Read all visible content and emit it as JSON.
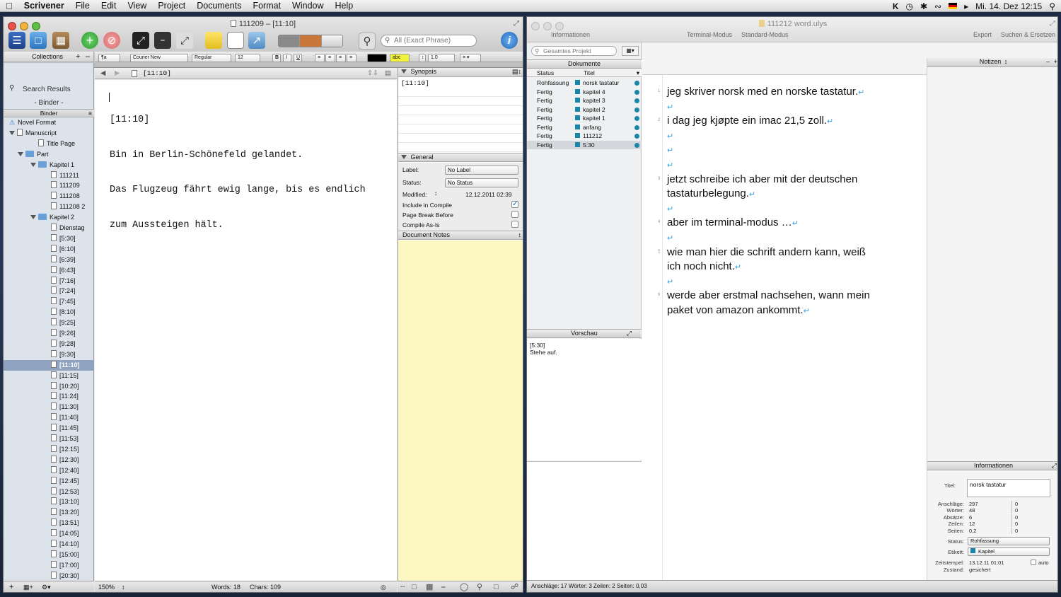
{
  "menubar": {
    "app_name": "Scrivener",
    "items": [
      "File",
      "Edit",
      "View",
      "Project",
      "Documents",
      "Format",
      "Window",
      "Help"
    ],
    "clock": "Mi. 14. Dez  12:15"
  },
  "scrivener": {
    "title": "111209 – [11:10]",
    "search_placeholder": "All (Exact Phrase)",
    "format": {
      "style": "¶a",
      "font": "Courier New",
      "weight": "Regular",
      "size": "12",
      "spacing": "1.0",
      "bold": "B",
      "italic": "I",
      "underline": "U",
      "highlight": "abc"
    },
    "collections_label": "Collections",
    "search_results_label": "Search Results",
    "binder_sep": "- Binder -",
    "binder_header": "Binder",
    "binder": [
      {
        "label": "Novel Format",
        "indent": 0,
        "icon": "warn",
        "tri": false
      },
      {
        "label": "Manuscript",
        "indent": 0,
        "icon": "doc",
        "tri": true
      },
      {
        "label": "Title Page",
        "indent": 2,
        "icon": "doc",
        "tri": false
      },
      {
        "label": "Part",
        "indent": 1,
        "icon": "folder",
        "tri": true
      },
      {
        "label": "Kapitel 1",
        "indent": 2,
        "icon": "folder",
        "tri": true
      },
      {
        "label": "111211",
        "indent": 3,
        "icon": "doc",
        "tri": false
      },
      {
        "label": "111209",
        "indent": 3,
        "icon": "doc",
        "tri": false
      },
      {
        "label": "111208",
        "indent": 3,
        "icon": "doc",
        "tri": false
      },
      {
        "label": "111208 2",
        "indent": 3,
        "icon": "doc",
        "tri": false
      },
      {
        "label": "Kapitel 2",
        "indent": 2,
        "icon": "folder",
        "tri": true
      },
      {
        "label": "Dienstag",
        "indent": 3,
        "icon": "doc",
        "tri": false
      },
      {
        "label": "[5:30]",
        "indent": 3,
        "icon": "doc",
        "tri": false
      },
      {
        "label": "[6:10]",
        "indent": 3,
        "icon": "doc",
        "tri": false
      },
      {
        "label": "[6:39]",
        "indent": 3,
        "icon": "doc",
        "tri": false
      },
      {
        "label": "[6:43]",
        "indent": 3,
        "icon": "doc",
        "tri": false
      },
      {
        "label": "[7:16]",
        "indent": 3,
        "icon": "doc",
        "tri": false
      },
      {
        "label": "[7:24]",
        "indent": 3,
        "icon": "doc",
        "tri": false
      },
      {
        "label": "[7:45]",
        "indent": 3,
        "icon": "doc",
        "tri": false
      },
      {
        "label": "[8:10]",
        "indent": 3,
        "icon": "doc",
        "tri": false
      },
      {
        "label": "[9:25]",
        "indent": 3,
        "icon": "doc",
        "tri": false
      },
      {
        "label": "[9:26]",
        "indent": 3,
        "icon": "doc",
        "tri": false
      },
      {
        "label": "[9:28]",
        "indent": 3,
        "icon": "doc",
        "tri": false
      },
      {
        "label": "[9:30]",
        "indent": 3,
        "icon": "doc",
        "tri": false
      },
      {
        "label": "[11:10]",
        "indent": 3,
        "icon": "doc",
        "tri": false,
        "selected": true
      },
      {
        "label": "[11:15]",
        "indent": 3,
        "icon": "doc",
        "tri": false
      },
      {
        "label": "[10:20]",
        "indent": 3,
        "icon": "doc",
        "tri": false
      },
      {
        "label": "[11:24]",
        "indent": 3,
        "icon": "doc",
        "tri": false
      },
      {
        "label": "[11:30]",
        "indent": 3,
        "icon": "doc",
        "tri": false
      },
      {
        "label": "[11:40]",
        "indent": 3,
        "icon": "doc",
        "tri": false
      },
      {
        "label": "[11:45]",
        "indent": 3,
        "icon": "doc",
        "tri": false
      },
      {
        "label": "[11:53]",
        "indent": 3,
        "icon": "doc",
        "tri": false
      },
      {
        "label": "[12:15]",
        "indent": 3,
        "icon": "doc",
        "tri": false
      },
      {
        "label": "[12:30]",
        "indent": 3,
        "icon": "doc",
        "tri": false
      },
      {
        "label": "[12:40]",
        "indent": 3,
        "icon": "doc",
        "tri": false
      },
      {
        "label": "[12:45]",
        "indent": 3,
        "icon": "doc",
        "tri": false
      },
      {
        "label": "[12:53]",
        "indent": 3,
        "icon": "doc",
        "tri": false
      },
      {
        "label": "[13:10]",
        "indent": 3,
        "icon": "doc",
        "tri": false
      },
      {
        "label": "[13:20]",
        "indent": 3,
        "icon": "doc",
        "tri": false
      },
      {
        "label": "[13:51]",
        "indent": 3,
        "icon": "doc",
        "tri": false
      },
      {
        "label": "[14:05]",
        "indent": 3,
        "icon": "doc",
        "tri": false
      },
      {
        "label": "[14:10]",
        "indent": 3,
        "icon": "doc",
        "tri": false
      },
      {
        "label": "[15:00]",
        "indent": 3,
        "icon": "doc",
        "tri": false
      },
      {
        "label": "[17:00]",
        "indent": 3,
        "icon": "doc",
        "tri": false
      },
      {
        "label": "[20:30]",
        "indent": 3,
        "icon": "doc",
        "tri": false
      }
    ],
    "editor_header": "[11:10]",
    "editor_lines": [
      "[11:10]",
      "Bin in Berlin-Schönefeld gelandet.",
      "Das Flugzeug fährt ewig lange, bis es endlich",
      "zum Aussteigen hält."
    ],
    "inspector": {
      "synopsis_label": "Synopsis",
      "synopsis_text": "[11:10]",
      "general_label": "General",
      "label_label": "Label:",
      "label_value": "No Label",
      "status_label": "Status:",
      "status_value": "No Status",
      "modified_label": "Modified:",
      "modified_value": "12.12.2011 02:39",
      "include_label": "Include in Compile",
      "pagebreak_label": "Page Break Before",
      "compileasis_label": "Compile As-Is",
      "notes_label": "Document Notes"
    },
    "status": {
      "zoom": "150%",
      "words": "Words: 18",
      "chars": "Chars: 109"
    }
  },
  "ulysses": {
    "title": "111212 word.ulys",
    "toolbar": {
      "info": "Informationen",
      "terminal": "Terminal-Modus",
      "standard": "Standard-Modus",
      "export": "Export",
      "search": "Suchen & Ersetzen"
    },
    "search_placeholder": "Gesamtes Projekt",
    "documents_header": "Dokumente",
    "col_status": "Status",
    "col_title": "Titel",
    "documents": [
      {
        "status": "Rohfassung",
        "title": "norsk tastatur"
      },
      {
        "status": "Fertig",
        "title": "kapitel 4"
      },
      {
        "status": "Fertig",
        "title": "kapitel 3"
      },
      {
        "status": "Fertig",
        "title": "kapitel 2"
      },
      {
        "status": "Fertig",
        "title": "kapitel 1"
      },
      {
        "status": "Fertig",
        "title": "anfang"
      },
      {
        "status": "Fertig",
        "title": "111212"
      },
      {
        "status": "Fertig",
        "title": "5:30",
        "selected": true
      }
    ],
    "tabs": [
      "111212",
      "kapitel 2",
      "kapitel 3",
      "kapitel 4",
      "norsk tastatur",
      "anfang",
      "5:30",
      "kapitel 1"
    ],
    "active_tab": "norsk tastatur",
    "preview_header": "Vorschau",
    "preview_lines": [
      "[5:30]",
      "Stehe auf."
    ],
    "editor": [
      {
        "n": "1",
        "text": "jeg skriver norsk med en norske tastatur."
      },
      {
        "n": "",
        "text": ""
      },
      {
        "n": "2",
        "text": "i dag jeg kjøpte ein imac 21,5 zoll."
      },
      {
        "n": "",
        "text": ""
      },
      {
        "n": "",
        "text": ""
      },
      {
        "n": "",
        "text": ""
      },
      {
        "n": "3",
        "text": "jetzt schreibe ich aber mit der deutschen"
      },
      {
        "n": "",
        "text": "tastaturbelegung."
      },
      {
        "n": "",
        "text": ""
      },
      {
        "n": "4",
        "text": "aber im terminal-modus …"
      },
      {
        "n": "",
        "text": ""
      },
      {
        "n": "5",
        "text": "wie man hier die schrift andern kann, weiß"
      },
      {
        "n": "",
        "text": "ich noch nicht."
      },
      {
        "n": "",
        "text": ""
      },
      {
        "n": "6",
        "text": "werde aber erstmal nachsehen, wann mein"
      },
      {
        "n": "",
        "text": "paket von amazon ankommt."
      }
    ],
    "notes_header": "Notizen",
    "info": {
      "header": "Informationen",
      "titel_label": "Titel:",
      "titel_value": "norsk tastatur",
      "stats": [
        {
          "label": "Anschläge:",
          "value": "297",
          "value2": "0"
        },
        {
          "label": "Wörter:",
          "value": "48",
          "value2": "0"
        },
        {
          "label": "Absätze:",
          "value": "6",
          "value2": "0"
        },
        {
          "label": "Zeilen:",
          "value": "12",
          "value2": "0"
        },
        {
          "label": "Seiten:",
          "value": "0,2",
          "value2": "0"
        }
      ],
      "status_label": "Status:",
      "status_value": "Rohfassung",
      "etikett_label": "Etikett:",
      "etikett_value": "Kapitel",
      "zeitstempel_label": "Zeitstempel:",
      "zeitstempel_value": "13.12.11 01:01",
      "auto_label": "auto",
      "zustand_label": "Zustand:",
      "zustand_value": "gesichert"
    },
    "statusbar": "Anschläge: 17  Wörter: 3  Zeilen: 2  Seiten: 0,03"
  },
  "colors": {
    "accent_teal": "#1a86a7",
    "binder_selection": "#8fa2bf",
    "notes_yellow": "#fdf8c2"
  }
}
